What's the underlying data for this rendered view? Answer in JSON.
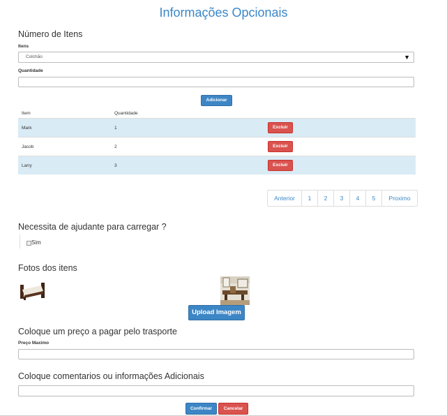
{
  "title": "Informações Opcionais",
  "items_section": {
    "heading": "Número de Itens",
    "select_label": "Itens",
    "select_value": "Colchão",
    "quantity_label": "Quantidade",
    "quantity_value": "",
    "add_button": "Adicionar"
  },
  "table": {
    "headers": [
      "Item",
      "Quantidade"
    ],
    "rows": [
      {
        "item": "Mark",
        "qty": "1",
        "action": "Excluir"
      },
      {
        "item": "Jacob",
        "qty": "2",
        "action": "Excluir"
      },
      {
        "item": "Larry",
        "qty": "3",
        "action": "Excluir"
      }
    ]
  },
  "pagination": {
    "prev": "Anterior",
    "pages": [
      "1",
      "2",
      "3",
      "4",
      "5"
    ],
    "next": "Proximo"
  },
  "helper": {
    "question": "Necessita de ajudante para carregar ?",
    "option": "Sim",
    "checked": false
  },
  "photos": {
    "heading": "Fotos dos itens",
    "upload_button": "Upload Imagem"
  },
  "price": {
    "heading": "Coloque um preço a pagar pelo trasporte",
    "label": "Preço Maximo",
    "value": ""
  },
  "comments": {
    "heading": "Coloque comentarios ou informações Adicionais",
    "value": ""
  },
  "actions": {
    "confirm": "Confirmar",
    "cancel": "Cancelar"
  },
  "colors": {
    "accent": "#3d86c6",
    "danger": "#d9534f",
    "stripe": "#d9ebf5",
    "title": "#3a87c8"
  }
}
